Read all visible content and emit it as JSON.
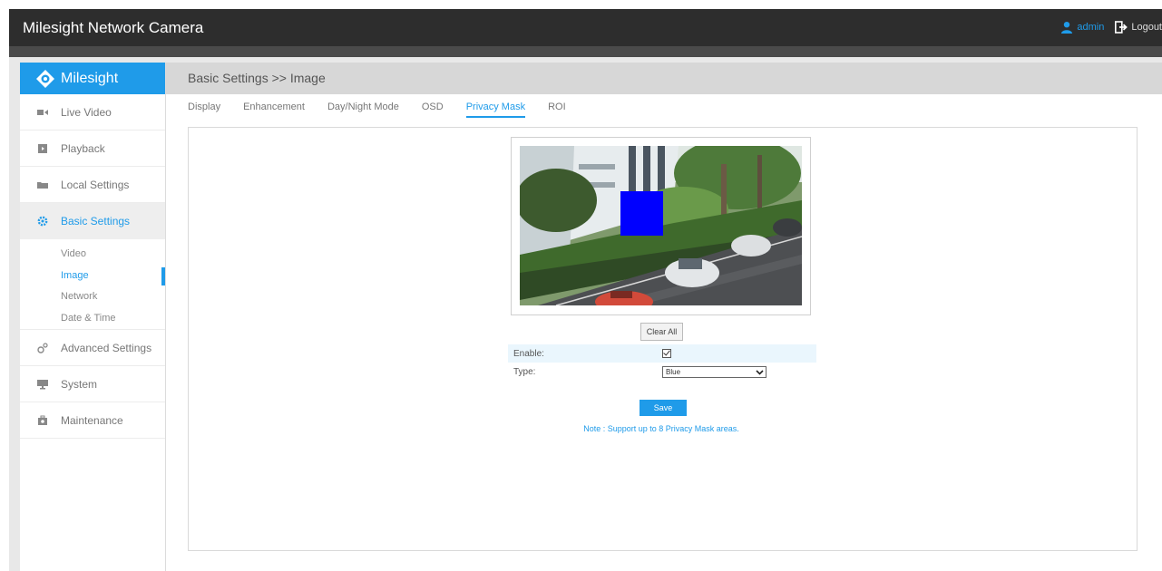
{
  "app": {
    "title": "Milesight Network Camera",
    "user": "admin",
    "logout": "Logout",
    "brand": "Milesight",
    "accent_color": "#1f9be9"
  },
  "sidebar": {
    "items": [
      {
        "label": "Live Video",
        "icon": "video-camera-icon"
      },
      {
        "label": "Playback",
        "icon": "playback-icon"
      },
      {
        "label": "Local Settings",
        "icon": "folder-icon"
      },
      {
        "label": "Basic Settings",
        "icon": "gear-icon",
        "active": true
      },
      {
        "label": "Advanced Settings",
        "icon": "gears-icon"
      },
      {
        "label": "System",
        "icon": "monitor-icon"
      },
      {
        "label": "Maintenance",
        "icon": "toolbox-icon"
      }
    ],
    "sub_items": [
      {
        "label": "Video"
      },
      {
        "label": "Image",
        "active": true
      },
      {
        "label": "Network"
      },
      {
        "label": "Date & Time"
      }
    ]
  },
  "breadcrumb": "Basic Settings >> Image",
  "tabs": [
    {
      "label": "Display"
    },
    {
      "label": "Enhancement"
    },
    {
      "label": "Day/Night Mode"
    },
    {
      "label": "OSD"
    },
    {
      "label": "Privacy Mask",
      "active": true
    },
    {
      "label": "ROI"
    }
  ],
  "privacy_mask": {
    "clear_all": "Clear All",
    "enable_label": "Enable:",
    "enable_checked": true,
    "type_label": "Type:",
    "type_value": "Blue",
    "mask_color": "#0000ff",
    "save": "Save",
    "note": "Note : Support up to 8 Privacy Mask areas."
  }
}
